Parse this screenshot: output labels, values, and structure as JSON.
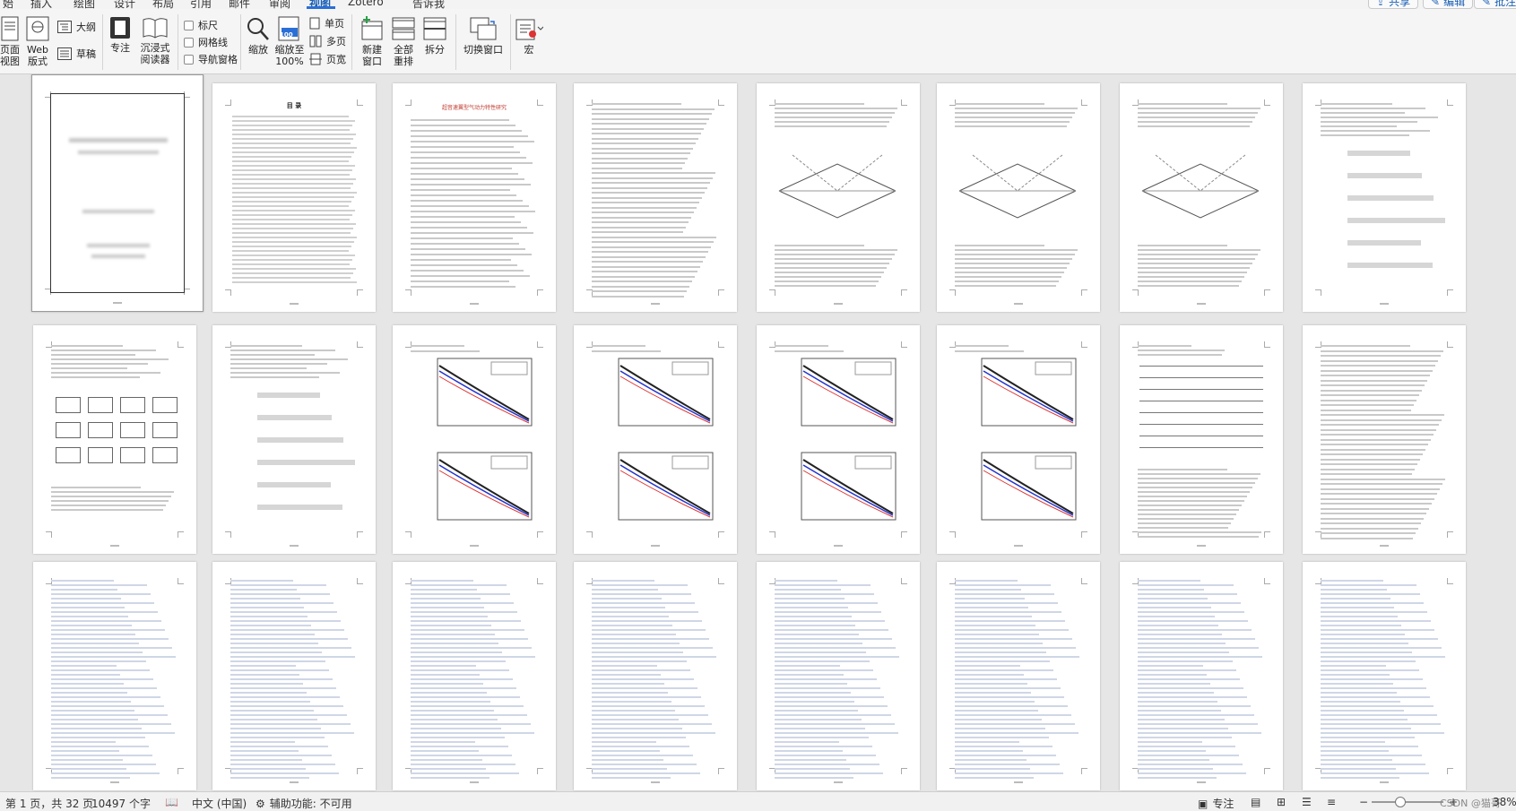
{
  "tabs": [
    "始",
    "插入",
    "绘图",
    "设计",
    "布局",
    "引用",
    "邮件",
    "审阅",
    "视图",
    "Zotero",
    "告诉我"
  ],
  "active_tab": "视图",
  "top_buttons": {
    "share": "共享",
    "edit": "编辑",
    "comment": "批注"
  },
  "ribbon": {
    "page_view": "页面\n视图",
    "web_view": "Web\n版式",
    "outline": "大纲",
    "draft": "草稿",
    "focus": "专注",
    "immersive_reader": "沉浸式\n阅读器",
    "ruler": "标尺",
    "gridlines": "网格线",
    "nav_pane": "导航窗格",
    "zoom": "缩放",
    "zoom_100": "缩放至\n100%",
    "zoom_100_icon_text": "100",
    "one_page": "单页",
    "multi_page": "多页",
    "page_width": "页宽",
    "new_window": "新建\n窗口",
    "arrange_all": "全部\n重排",
    "split": "拆分",
    "switch_windows": "切换窗口",
    "macros": "宏"
  },
  "status": {
    "page_info": "第 1 页，共 32 页",
    "word_count": "10497 个字",
    "language": "中文 (中国)",
    "accessibility": "辅助功能: 不可用",
    "focus": "专注",
    "zoom": "38%",
    "watermark": "CSDN @猫哥"
  },
  "colors": {
    "accent": "#2b6fd6",
    "ribbon_bg": "#f5f5f5",
    "canvas_bg": "#e6e6e6"
  },
  "pages": [
    {
      "type": "cover"
    },
    {
      "type": "toc",
      "title": "目 录"
    },
    {
      "type": "title",
      "title": "超音速翼型气动力特性研究"
    },
    {
      "type": "text"
    },
    {
      "type": "diagram"
    },
    {
      "type": "diagram"
    },
    {
      "type": "diagram"
    },
    {
      "type": "formula"
    },
    {
      "type": "flowchart"
    },
    {
      "type": "formula"
    },
    {
      "type": "chart"
    },
    {
      "type": "chart"
    },
    {
      "type": "chart"
    },
    {
      "type": "chart"
    },
    {
      "type": "table"
    },
    {
      "type": "text"
    },
    {
      "type": "code"
    },
    {
      "type": "code"
    },
    {
      "type": "code"
    },
    {
      "type": "code"
    },
    {
      "type": "code"
    },
    {
      "type": "code"
    },
    {
      "type": "code"
    },
    {
      "type": "code"
    }
  ]
}
